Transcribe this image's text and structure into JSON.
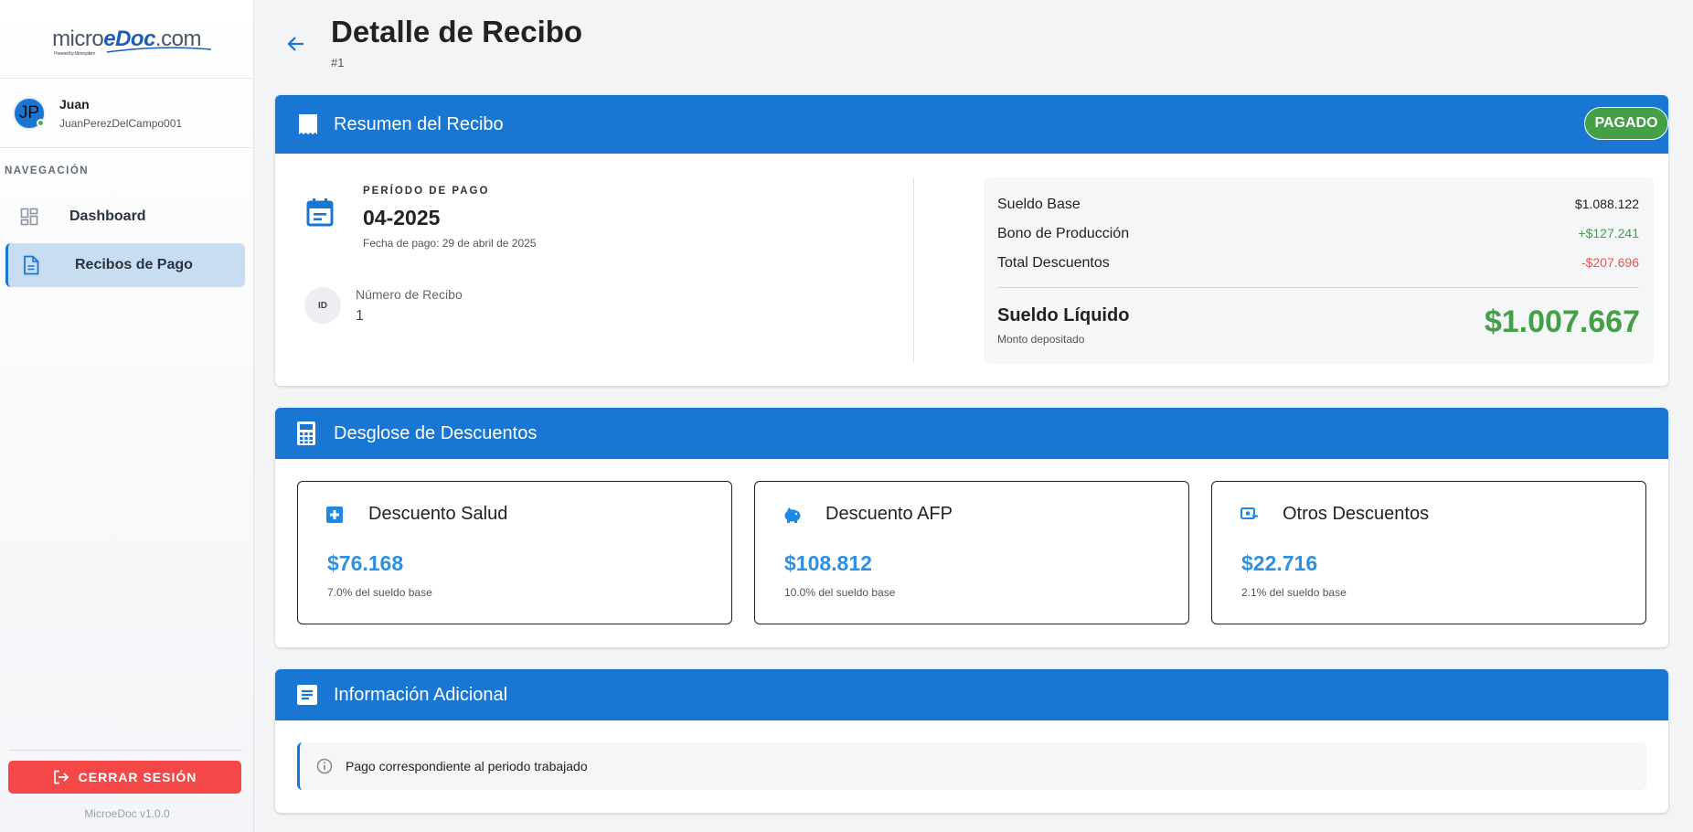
{
  "brand": {
    "name_m": "micro",
    "name_e": "eDoc",
    "name_rest": ".com",
    "tagline": "Powered by Microsystem"
  },
  "user": {
    "initials": "JP",
    "name": "Juan",
    "handle": "JuanPerezDelCampo001"
  },
  "nav": {
    "title": "NAVEGACIÓN",
    "items": [
      {
        "label": "Dashboard",
        "icon": "dashboard-icon"
      },
      {
        "label": "Recibos de Pago",
        "icon": "document-icon"
      }
    ]
  },
  "sidebar_footer": {
    "logout_label": "CERRAR SESIÓN",
    "version": "MicroeDoc v1.0.0"
  },
  "header": {
    "title": "Detalle de Recibo",
    "subtitle": "#1"
  },
  "summary_card": {
    "title": "Resumen del Recibo",
    "status": "PAGADO",
    "period_label": "PERÍODO DE PAGO",
    "period_value": "04-2025",
    "payment_date": "Fecha de pago: 29 de abril de 2025",
    "id_badge": "ID",
    "receipt_number_label": "Número de Recibo",
    "receipt_number_value": "1",
    "rows": [
      {
        "label": "Sueldo Base",
        "amount": "$1.088.122"
      },
      {
        "label": "Bono de Producción",
        "amount": "+$127.241"
      },
      {
        "label": "Total Descuentos",
        "amount": "-$207.696"
      }
    ],
    "net_label": "Sueldo Líquido",
    "net_sub": "Monto depositado",
    "net_value": "$1.007.667"
  },
  "discounts_card": {
    "title": "Desglose de Descuentos",
    "items": [
      {
        "title": "Descuento Salud",
        "value": "$76.168",
        "pct": "7.0% del sueldo base"
      },
      {
        "title": "Descuento AFP",
        "value": "$108.812",
        "pct": "10.0% del sueldo base"
      },
      {
        "title": "Otros Descuentos",
        "value": "$22.716",
        "pct": "2.1% del sueldo base"
      }
    ]
  },
  "info_card": {
    "title": "Información Adicional",
    "message": "Pago correspondiente al periodo trabajado"
  },
  "colors": {
    "primary": "#1976d2",
    "success": "#43a047",
    "danger": "#ef5350",
    "logout": "#f44848",
    "amount_blue": "#2f8fe0"
  }
}
